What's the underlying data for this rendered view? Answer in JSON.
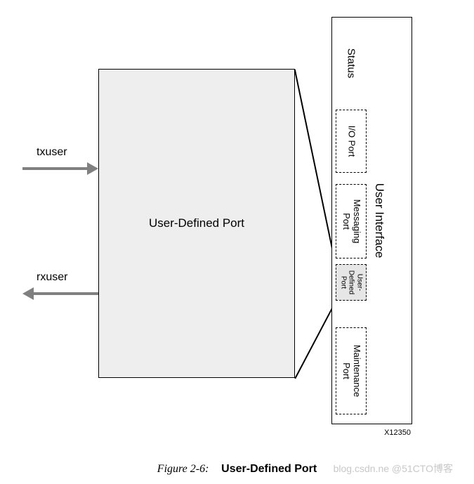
{
  "arrows": {
    "tx_label": "txuser",
    "rx_label": "rxuser"
  },
  "main_box": {
    "label": "User-Defined Port"
  },
  "user_interface": {
    "label": "User Interface",
    "status_label": "Status",
    "ports": {
      "io": "I/O Port",
      "messaging": "Messaging\nPort",
      "user_defined": "User-\nDefined\nPort",
      "maintenance": "Maintenance\nPort"
    }
  },
  "xref": "X12350",
  "caption": {
    "prefix": "Figure 2-6:",
    "title": "User-Defined Port"
  },
  "watermark": "blog.csdn.ne  @51CTO博客"
}
